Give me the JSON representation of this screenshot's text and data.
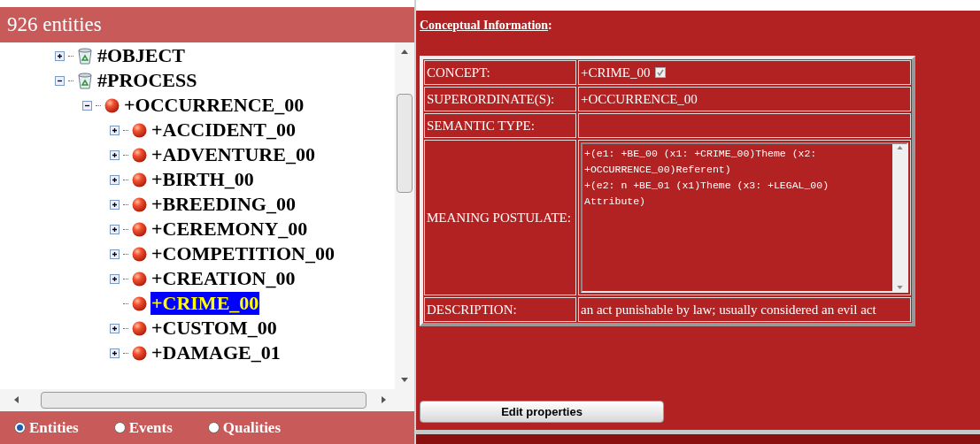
{
  "header": {
    "title": "926 entities"
  },
  "tree": [
    {
      "label": "#OBJECT",
      "kind": "bin",
      "expanded": false,
      "selected": false
    },
    {
      "label": "#PROCESS",
      "kind": "bin",
      "expanded": true,
      "selected": false,
      "children": [
        {
          "label": "+OCCURRENCE_00",
          "kind": "ball",
          "expanded": true,
          "selected": false,
          "children": [
            {
              "label": "+ACCIDENT_00",
              "kind": "ball",
              "expanded": false,
              "selected": false
            },
            {
              "label": "+ADVENTURE_00",
              "kind": "ball",
              "expanded": false,
              "selected": false
            },
            {
              "label": "+BIRTH_00",
              "kind": "ball",
              "expanded": false,
              "selected": false
            },
            {
              "label": "+BREEDING_00",
              "kind": "ball",
              "expanded": false,
              "selected": false
            },
            {
              "label": "+CEREMONY_00",
              "kind": "ball",
              "expanded": false,
              "selected": false
            },
            {
              "label": "+COMPETITION_00",
              "kind": "ball",
              "expanded": false,
              "selected": false
            },
            {
              "label": "+CREATION_00",
              "kind": "ball",
              "expanded": false,
              "selected": false
            },
            {
              "label": "+CRIME_00",
              "kind": "ball",
              "selected": true
            },
            {
              "label": "+CUSTOM_00",
              "kind": "ball",
              "expanded": false,
              "selected": false
            },
            {
              "label": "+DAMAGE_01",
              "kind": "ball",
              "expanded": false,
              "selected": false
            }
          ]
        }
      ]
    }
  ],
  "filters": [
    {
      "label": "Entities",
      "selected": true
    },
    {
      "label": "Events",
      "selected": false
    },
    {
      "label": "Qualities",
      "selected": false
    }
  ],
  "section_title": "Conceptual Information",
  "section_colon": ":",
  "fields": [
    {
      "kind": "text",
      "label": "CONCEPT:",
      "value": "+CRIME_00",
      "checked": true
    },
    {
      "kind": "text",
      "label": "SUPERORDINATE(S):",
      "value": "+OCCURRENCE_00"
    },
    {
      "kind": "text",
      "label": "SEMANTIC TYPE:"
    },
    {
      "kind": "postulate",
      "label": "MEANING POSTULATE:",
      "lines": [
        "+(e1: +BE_00 (x1: +CRIME_00)Theme (x2:",
        "+OCCURRENCE_00)Referent)",
        "+(e2: n +BE_01 (x1)Theme (x3: +LEGAL_00)",
        "Attribute)"
      ]
    },
    {
      "kind": "text",
      "label": "DESCRIPTION:",
      "value": "an act punishable by law; usually considered an evil act"
    }
  ],
  "edit_button": "Edit properties"
}
